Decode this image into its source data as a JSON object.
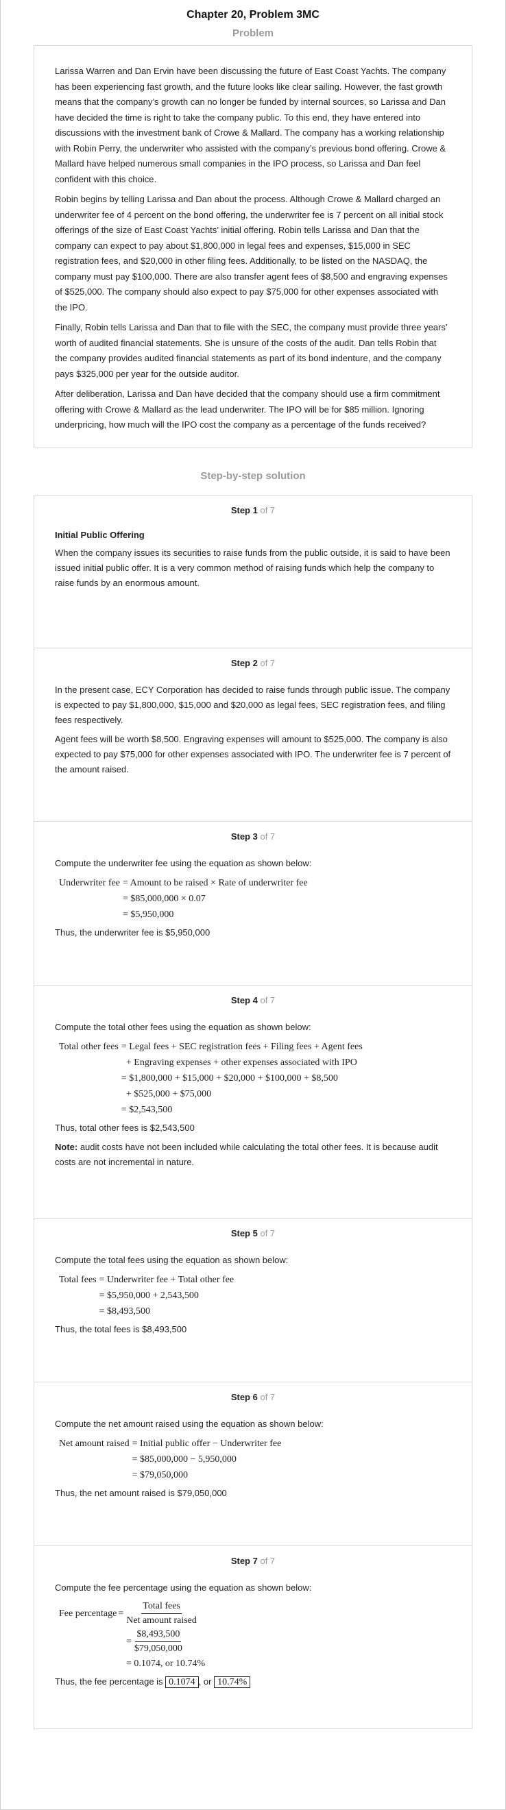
{
  "title": "Chapter 20, Problem 3MC",
  "problem_heading": "Problem",
  "problem_paragraphs": [
    "Larissa Warren and Dan Ervin have been discussing the future of East Coast Yachts. The company has been experiencing fast growth, and the future looks like clear sailing. However, the fast growth means that the company’s growth can no longer be funded by internal sources, so Larissa and Dan have decided the time is right to take the company public. To this end, they have entered into discussions with the investment bank of Crowe & Mallard. The company has a working relationship with Robin Perry, the underwriter who assisted with the company’s previous bond offering. Crowe & Mallard have helped numerous small companies in the IPO process, so Larissa and Dan feel confident with this choice.",
    "Robin begins by telling Larissa and Dan about the process. Although Crowe & Mallard charged an underwriter fee of 4 percent on the bond offering, the underwriter fee is 7 percent on all initial stock offerings of the size of East Coast Yachts’ initial offering. Robin tells Larissa and Dan that the company can expect to pay about $1,800,000 in legal fees and expenses, $15,000 in SEC registration fees, and $20,000 in other filing fees. Additionally, to be listed on the NASDAQ, the company must pay $100,000. There are also transfer agent fees of $8,500 and engraving expenses of $525,000. The company should also expect to pay $75,000 for other expenses associated with the IPO.",
    "Finally, Robin tells Larissa and Dan that to file with the SEC, the company must provide three years’ worth of audited financial statements. She is unsure of the costs of the audit. Dan tells Robin that the company provides audited financial statements as part of its bond indenture, and the company pays $325,000 per year for the outside auditor.",
    "After deliberation, Larissa and Dan have decided that the company should use a firm commitment offering with Crowe & Mallard as the lead underwriter. The IPO will be for $85 million. Ignoring underpricing, how much will the IPO cost the company as a percentage of the funds received?"
  ],
  "solution_heading": "Step-by-step solution",
  "steps": [
    {
      "label": "Step 1",
      "of": "of 7",
      "heading": "Initial Public Offering",
      "text": "When the company issues its securities to raise funds from the public outside, it is said to have been issued initial public offer. It is a very common method of raising funds which help the company to raise funds by an enormous amount."
    },
    {
      "label": "Step 2",
      "of": "of 7",
      "p1": "In the present case, ECY Corporation has decided to raise funds through public issue. The company is expected to pay $1,800,000, $15,000 and $20,000 as legal fees, SEC registration fees, and filing fees respectively.",
      "p2": "Agent fees will be worth $8,500. Engraving expenses will amount to $525,000. The company is also expected to pay $75,000 for other expenses associated with IPO. The underwriter fee is 7 percent of the amount raised."
    },
    {
      "label": "Step 3",
      "of": "of 7",
      "intro": "Compute the underwriter fee using the equation as shown below:",
      "eq_lhs": "Underwriter fee",
      "eq_lines": [
        "= Amount to be raised × Rate of underwriter fee",
        "= $85,000,000 × 0.07",
        "= $5,950,000"
      ],
      "result": "Thus, the underwriter fee is $5,950,000"
    },
    {
      "label": "Step 4",
      "of": "of 7",
      "intro": "Compute the total other fees using the equation as shown below:",
      "eq_lhs": "Total other fees",
      "eq_lines": [
        "= Legal fees + SEC registration fees + Filing fees + Agent fees",
        "  + Engraving expenses + other expenses associated with IPO",
        "= $1,800,000 + $15,000 + $20,000 + $100,000 + $8,500",
        "  + $525,000 + $75,000",
        "= $2,543,500"
      ],
      "result": "Thus, total other fees is $2,543,500",
      "note_label": "Note:",
      "note": " audit costs have not been included while calculating the total other fees. It is because audit costs are not incremental in nature."
    },
    {
      "label": "Step 5",
      "of": "of 7",
      "intro": "Compute the total fees using the equation as shown below:",
      "eq_lhs": "Total fees",
      "eq_lines": [
        "= Underwriter fee + Total other fee",
        "= $5,950,000 + 2,543,500",
        "= $8,493,500"
      ],
      "result": "Thus, the total fees is $8,493,500"
    },
    {
      "label": "Step 6",
      "of": "of 7",
      "intro": "Compute the net amount raised using the equation as shown below:",
      "eq_lhs": "Net amount raised",
      "eq_lines": [
        "= Initial public offer − Underwriter fee",
        "= $85,000,000 − 5,950,000",
        "= $79,050,000"
      ],
      "result": "Thus, the net amount raised is $79,050,000"
    },
    {
      "label": "Step 7",
      "of": "of 7",
      "intro": "Compute the fee percentage using the equation as shown below:",
      "eq_lhs": "Fee percentage",
      "frac1_num": "Total fees",
      "frac1_den": "Net amount raised",
      "frac2_num": "$8,493,500",
      "frac2_den": "$79,050,000",
      "eq_final": "= 0.1074, or 10.74%",
      "result_prefix": "Thus, the fee percentage is ",
      "answer1": "0.1074",
      "result_mid": ", or ",
      "answer2": "10.74%"
    }
  ]
}
